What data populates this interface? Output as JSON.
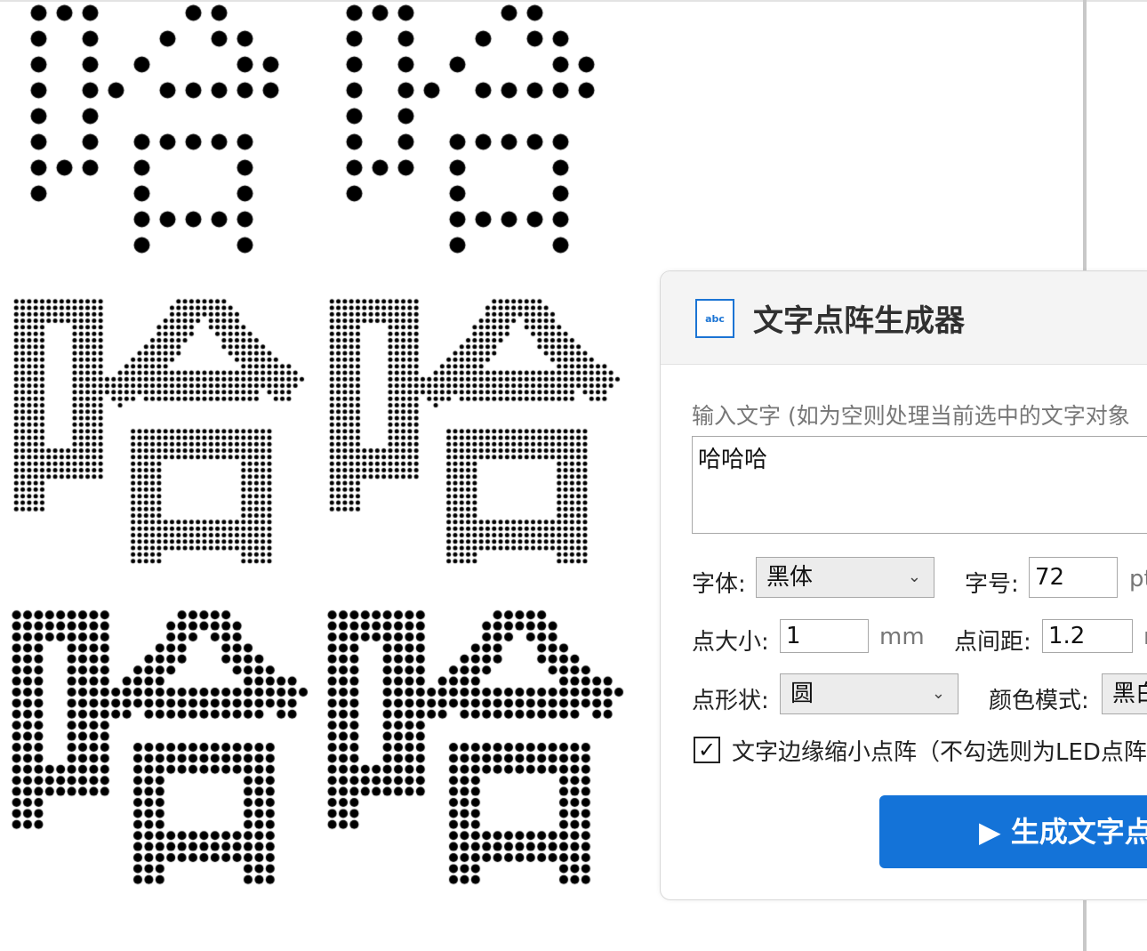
{
  "panel": {
    "icon_label": "abc",
    "title": "文字点阵生成器",
    "input_hint": "输入文字 (如为空则处理当前选中的文字对象",
    "text_value": "哈哈哈",
    "font_label": "字体:",
    "font_value": "黑体",
    "size_label": "字号:",
    "size_value": "72",
    "size_unit": "pt",
    "dot_size_label": "点大小:",
    "dot_size_value": "1",
    "dot_size_unit": "mm",
    "dot_gap_label": "点间距:",
    "dot_gap_value": "1.2",
    "dot_gap_unit": "m",
    "shape_label": "点形状:",
    "shape_value": "圆",
    "color_mode_label": "颜色模式:",
    "color_mode_value": "黑白",
    "shrink_checkbox_checked": true,
    "shrink_label": "文字边缘缩小点阵（不勾选则为LED点阵",
    "generate_button": "▶ 生成文字点"
  },
  "colors": {
    "accent": "#1473d8",
    "dots": "#000000",
    "icon_border": "#1b74d4"
  },
  "canvas": {
    "glyph": "哈",
    "blocks": [
      {
        "glyph_count": 2,
        "dot_pitch": 29,
        "dot_diameter": 18
      },
      {
        "glyph_count": 2,
        "dot_pitch": 7.3,
        "dot_diameter": 5
      },
      {
        "glyph_count": 2,
        "dot_pitch": 12.4,
        "dot_diameter": 10
      }
    ]
  }
}
